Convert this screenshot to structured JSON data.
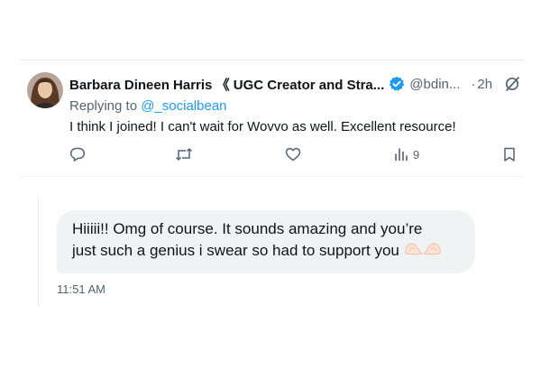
{
  "tweet": {
    "author_name": "Barbara Dineen Harris 《 UGC Creator and Stra...",
    "handle": "@bdin...",
    "separator": "·",
    "time_ago": "2h",
    "replying_prefix": "Replying to",
    "replying_to": "@_socialbean",
    "text": "I think I joined! I can't wait for Wovvo as well. Excellent resource!",
    "views_count": "9",
    "icons": [
      "verified-badge",
      "grok",
      "reply",
      "retweet",
      "like",
      "views",
      "bookmark"
    ],
    "colors": {
      "accent": "#1d9bf0",
      "secondary_text": "#536471",
      "mention": "#1d9bf0"
    }
  },
  "message": {
    "line1": "Hiiiii!! Omg of course. It sounds amazing and you’re",
    "line2": "just such a genius i swear so had to support you",
    "emoji": "heart-hands",
    "timestamp": "11:51 AM",
    "bubble_color": "#eff3f4"
  }
}
